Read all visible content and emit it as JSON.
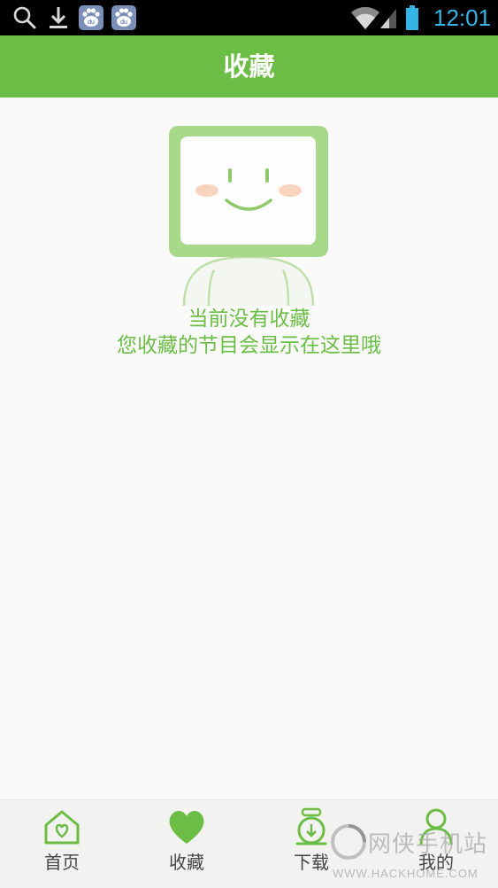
{
  "status_bar": {
    "time": "12:01",
    "icons": [
      "search-icon",
      "download-icon",
      "baidu-icon",
      "baidu-icon",
      "wifi-icon",
      "signal-icon",
      "battery-icon"
    ]
  },
  "header": {
    "title": "收藏"
  },
  "empty_state": {
    "line1": "当前没有收藏",
    "line2": "您收藏的节目会显示在这里哦"
  },
  "bottom_nav": {
    "items": [
      {
        "label": "首页",
        "icon": "home-icon",
        "active": false
      },
      {
        "label": "收藏",
        "icon": "heart-icon",
        "active": true
      },
      {
        "label": "下载",
        "icon": "download-icon",
        "active": false
      },
      {
        "label": "我的",
        "icon": "user-icon",
        "active": false
      }
    ]
  },
  "watermark": {
    "text": "网侠手机站",
    "url": "WWW.HACKHOME.COM"
  },
  "colors": {
    "accent": "#6cbd45",
    "status_time": "#33b5e5",
    "background": "#fafafa",
    "nav_background": "#f2f2f0"
  }
}
